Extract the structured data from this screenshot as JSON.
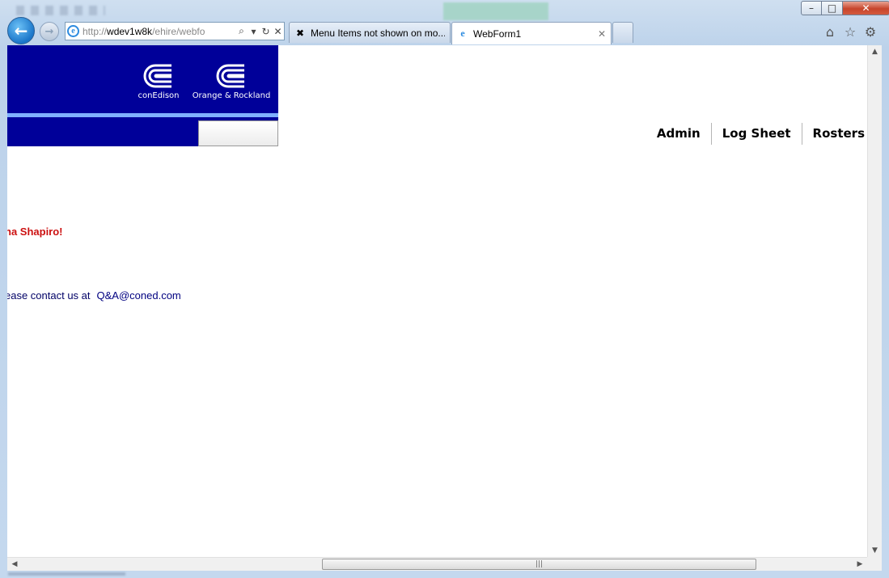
{
  "browser": {
    "address_bar": {
      "url_prefix": "http://",
      "url_host": "wdev1w8k",
      "url_path": "/ehire/webfo"
    },
    "tabs": [
      {
        "label": "Menu Items not shown on mo...",
        "icon": "stack-exchange-icon"
      },
      {
        "label": "WebForm1",
        "icon": "ie-icon",
        "active": true
      }
    ],
    "window_controls": {
      "minimize": "–",
      "maximize": "□",
      "close": "✕"
    },
    "toolbar_icons": [
      "home-icon",
      "favorites-star-icon",
      "gear-icon"
    ]
  },
  "page": {
    "logos": [
      {
        "caption": "conEdison"
      },
      {
        "caption": "Orange & Rockland"
      }
    ],
    "menu": {
      "items": [
        "Admin",
        "Log Sheet",
        "Rosters"
      ]
    },
    "welcome_text": "na Shapiro!",
    "contact": {
      "text": "ease contact us at",
      "email": "Q&A@coned.com"
    }
  },
  "colors": {
    "banner": "#000099",
    "banner_strip": "#7fb0ff",
    "welcome": "#cc1111",
    "contact": "#000066"
  }
}
